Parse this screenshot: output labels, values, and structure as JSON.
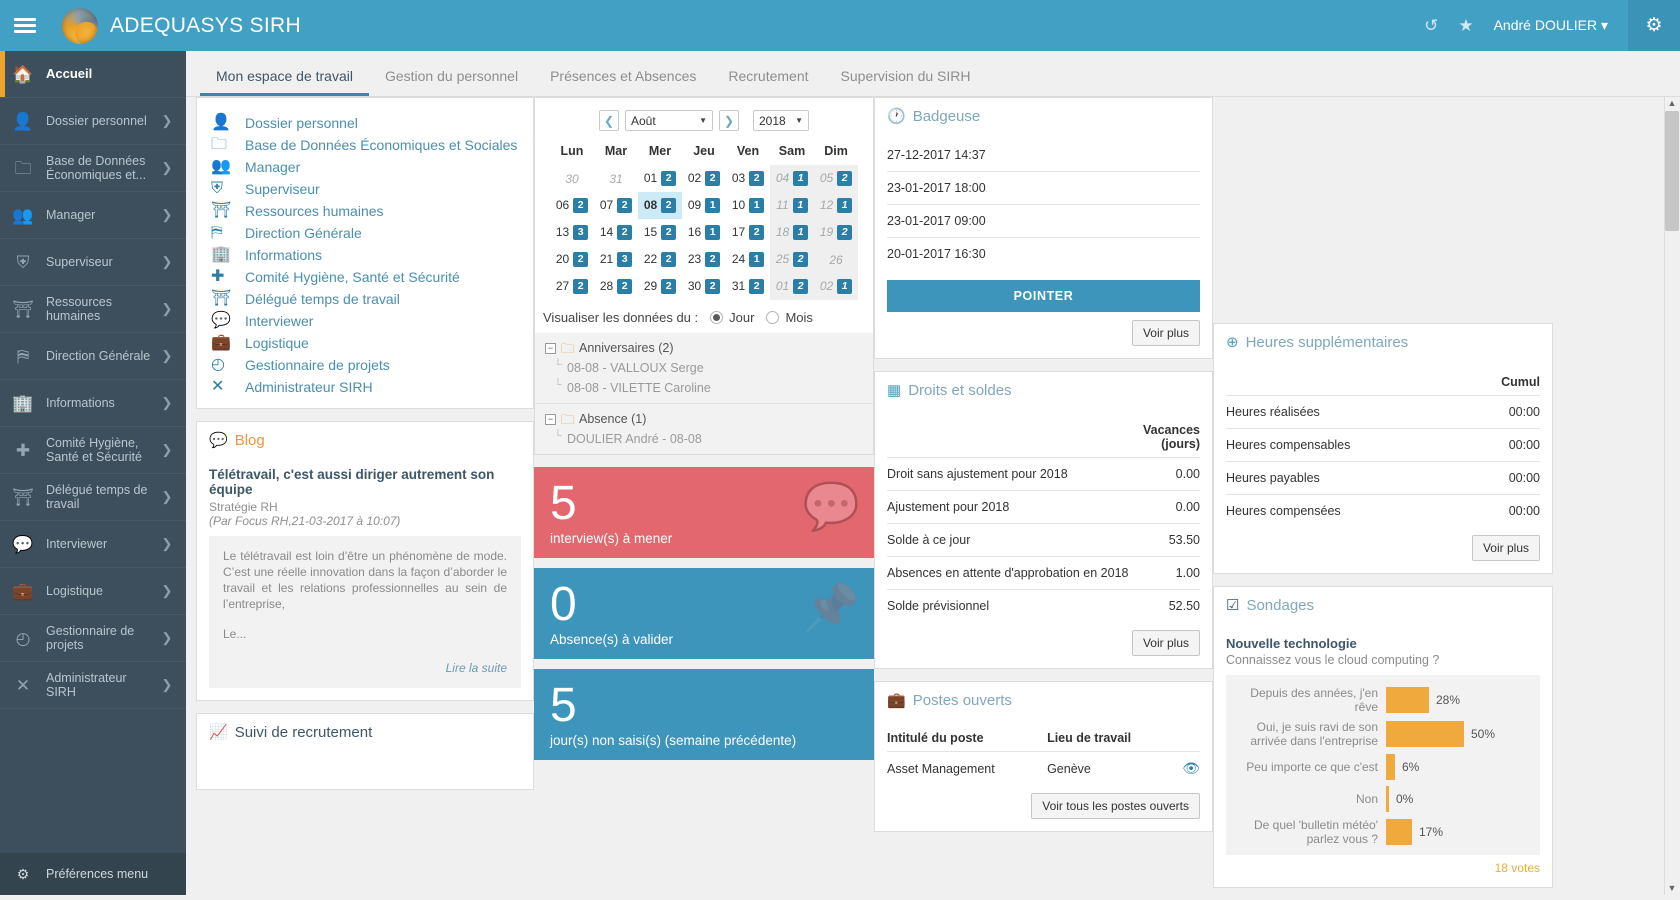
{
  "topbar": {
    "app_title": "ADEQUASYS SIRH",
    "user_name": "André DOULIER ",
    "user_caret": "▾",
    "history_icon": "↺",
    "star_icon": "★",
    "gear_icon": "⚙",
    "menu_icon": "hamburger"
  },
  "sidebar": {
    "items": [
      {
        "label": "Accueil",
        "icon": "🏠",
        "chevron": "",
        "active": true
      },
      {
        "label": "Dossier personnel",
        "icon": "👤",
        "chevron": "❯",
        "active": false
      },
      {
        "label": "Base de Données Économiques et...",
        "icon": "🗀",
        "chevron": "❯",
        "active": false
      },
      {
        "label": "Manager",
        "icon": "👥",
        "chevron": "❯",
        "active": false
      },
      {
        "label": "Superviseur",
        "icon": "⛨",
        "chevron": "❯",
        "active": false
      },
      {
        "label": "Ressources humaines",
        "icon": "⛩",
        "chevron": "❯",
        "active": false
      },
      {
        "label": "Direction Générale",
        "icon": "⛿",
        "chevron": "❯",
        "active": false
      },
      {
        "label": "Informations",
        "icon": "🏢",
        "chevron": "❯",
        "active": false
      },
      {
        "label": "Comité Hygiène, Santé et Sécurité",
        "icon": "✚",
        "chevron": "❯",
        "active": false
      },
      {
        "label": "Délégué temps de travail",
        "icon": "⛩",
        "chevron": "❯",
        "active": false
      },
      {
        "label": "Interviewer",
        "icon": "💬",
        "chevron": "❯",
        "active": false
      },
      {
        "label": "Logistique",
        "icon": "💼",
        "chevron": "❯",
        "active": false
      },
      {
        "label": "Gestionnaire de projets",
        "icon": "◴",
        "chevron": "❯",
        "active": false
      },
      {
        "label": "Administrateur SIRH",
        "icon": "✕",
        "chevron": "❯",
        "active": false
      }
    ],
    "prefs_label": "Préférences menu",
    "prefs_icon": "⚙"
  },
  "tabs": [
    {
      "label": "Mon espace de travail",
      "active": true
    },
    {
      "label": "Gestion du personnel",
      "active": false
    },
    {
      "label": "Présences et Absences",
      "active": false
    },
    {
      "label": "Recrutement",
      "active": false
    },
    {
      "label": "Supervision du SIRH",
      "active": false
    }
  ],
  "shortcuts": [
    {
      "label": "Dossier personnel",
      "icon": "👤"
    },
    {
      "label": "Base de Données Économiques et Sociales",
      "icon": "🗀"
    },
    {
      "label": "Manager",
      "icon": "👥"
    },
    {
      "label": "Superviseur",
      "icon": "⛨"
    },
    {
      "label": "Ressources humaines",
      "icon": "⛩"
    },
    {
      "label": "Direction Générale",
      "icon": "⛿"
    },
    {
      "label": "Informations",
      "icon": "🏢"
    },
    {
      "label": "Comité Hygiène, Santé et Sécurité",
      "icon": "✚"
    },
    {
      "label": "Délégué temps de travail",
      "icon": "⛩"
    },
    {
      "label": "Interviewer",
      "icon": "💬"
    },
    {
      "label": "Logistique",
      "icon": "💼"
    },
    {
      "label": "Gestionnaire de projets",
      "icon": "◴"
    },
    {
      "label": "Administrateur SIRH",
      "icon": "✕"
    }
  ],
  "blog": {
    "title": "Blog",
    "icon": "💬",
    "headline": "Télétravail, c'est aussi diriger autrement son équipe",
    "category": "Stratégie RH",
    "meta": "(Par Focus RH,21-03-2017 à 10:07)",
    "excerpt": "Le télétravail est loin d’être un phénomène de mode. C’est une réelle innovation dans la façon d’aborder le travail et les relations professionnelles au sein de l’entreprise,",
    "excerpt_cont": "Le...",
    "read_more": "Lire la suite"
  },
  "recruitment": {
    "title": "Suivi de recrutement",
    "icon": "📈"
  },
  "calendar": {
    "prev_icon": "❮",
    "next_icon": "❯",
    "month": "Août",
    "year": "2018",
    "caret": "▼",
    "day_headers": [
      "Lun",
      "Mar",
      "Mer",
      "Jeu",
      "Ven",
      "Sam",
      "Dim"
    ],
    "weeks": [
      [
        {
          "d": "30",
          "b": "",
          "other": true,
          "we": false
        },
        {
          "d": "31",
          "b": "",
          "other": true,
          "we": false
        },
        {
          "d": "01",
          "b": "2",
          "other": false,
          "we": false
        },
        {
          "d": "02",
          "b": "2",
          "other": false,
          "we": false
        },
        {
          "d": "03",
          "b": "2",
          "other": false,
          "we": false
        },
        {
          "d": "04",
          "b": "1",
          "other": true,
          "we": true
        },
        {
          "d": "05",
          "b": "2",
          "other": true,
          "we": true
        }
      ],
      [
        {
          "d": "06",
          "b": "2",
          "other": false,
          "we": false
        },
        {
          "d": "07",
          "b": "2",
          "other": false,
          "we": false
        },
        {
          "d": "08",
          "b": "2",
          "other": false,
          "we": false,
          "sel": true
        },
        {
          "d": "09",
          "b": "1",
          "other": false,
          "we": false
        },
        {
          "d": "10",
          "b": "1",
          "other": false,
          "we": false
        },
        {
          "d": "11",
          "b": "1",
          "other": true,
          "we": true
        },
        {
          "d": "12",
          "b": "1",
          "other": true,
          "we": true
        }
      ],
      [
        {
          "d": "13",
          "b": "3",
          "other": false,
          "we": false
        },
        {
          "d": "14",
          "b": "2",
          "other": false,
          "we": false
        },
        {
          "d": "15",
          "b": "2",
          "other": false,
          "we": false
        },
        {
          "d": "16",
          "b": "1",
          "other": false,
          "we": false
        },
        {
          "d": "17",
          "b": "2",
          "other": false,
          "we": false
        },
        {
          "d": "18",
          "b": "1",
          "other": true,
          "we": true
        },
        {
          "d": "19",
          "b": "2",
          "other": true,
          "we": true
        }
      ],
      [
        {
          "d": "20",
          "b": "2",
          "other": false,
          "we": false
        },
        {
          "d": "21",
          "b": "3",
          "other": false,
          "we": false
        },
        {
          "d": "22",
          "b": "2",
          "other": false,
          "we": false
        },
        {
          "d": "23",
          "b": "2",
          "other": false,
          "we": false
        },
        {
          "d": "24",
          "b": "1",
          "other": false,
          "we": false
        },
        {
          "d": "25",
          "b": "2",
          "other": true,
          "we": true
        },
        {
          "d": "26",
          "b": "",
          "other": true,
          "we": true
        }
      ],
      [
        {
          "d": "27",
          "b": "2",
          "other": false,
          "we": false
        },
        {
          "d": "28",
          "b": "2",
          "other": false,
          "we": false
        },
        {
          "d": "29",
          "b": "2",
          "other": false,
          "we": false
        },
        {
          "d": "30",
          "b": "2",
          "other": false,
          "we": false
        },
        {
          "d": "31",
          "b": "2",
          "other": false,
          "we": false
        },
        {
          "d": "01",
          "b": "2",
          "other": true,
          "we": true
        },
        {
          "d": "02",
          "b": "1",
          "other": true,
          "we": true
        }
      ]
    ],
    "visualize_label": "Visualiser les données du :",
    "radio_day": "Jour",
    "radio_month": "Mois",
    "tree": [
      {
        "group": "Anniversaires (2)",
        "items": [
          "08-08 - VALLOUX Serge",
          "08-08 - VILETTE Caroline"
        ]
      },
      {
        "group": "Absence (1)",
        "items": [
          "DOULIER André - 08-08"
        ]
      }
    ]
  },
  "tiles": [
    {
      "num": "5",
      "caption": "interview(s) à mener",
      "color": "#e3676f",
      "icon": "💬"
    },
    {
      "num": "0",
      "caption": "Absence(s) à valider",
      "color": "#3d95bb",
      "icon": "📌"
    },
    {
      "num": "5",
      "caption": "jour(s) non saisi(s) (semaine précédente)",
      "color": "#3d95bb",
      "icon": ""
    }
  ],
  "badgeuse": {
    "title": "Badgeuse",
    "icon": "🕐",
    "entries": [
      "27-12-2017 14:37",
      "23-01-2017 18:00",
      "23-01-2017 09:00",
      "20-01-2017 16:30"
    ],
    "action_label": "POINTER",
    "more_label": "Voir plus"
  },
  "droits": {
    "title": "Droits et soldes",
    "icon": "▦",
    "col_header": "Vacances\n(jours)",
    "col_header_l1": "Vacances",
    "col_header_l2": "(jours)",
    "rows": [
      {
        "label": "Droit sans ajustement pour 2018",
        "value": "0.00"
      },
      {
        "label": "Ajustement pour 2018",
        "value": "0.00"
      },
      {
        "label": "Solde à ce jour",
        "value": "53.50"
      },
      {
        "label": "Absences en attente d'approbation en 2018",
        "value": "1.00"
      },
      {
        "label": "Solde prévisionnel",
        "value": "52.50"
      }
    ],
    "more_label": "Voir plus"
  },
  "postes": {
    "title": "Postes ouverts",
    "icon": "💼",
    "headers": [
      "Intitulé du poste",
      "Lieu de travail",
      ""
    ],
    "rows": [
      {
        "poste": "Asset Management",
        "lieu": "Genève",
        "eye": "👁"
      }
    ],
    "all_label": "Voir tous les postes ouverts"
  },
  "heures": {
    "title": "Heures supplémentaires",
    "icon": "⊕",
    "col_header": "Cumul",
    "rows": [
      {
        "label": "Heures réalisées",
        "value": "00:00"
      },
      {
        "label": "Heures compensables",
        "value": "00:00"
      },
      {
        "label": "Heures payables",
        "value": "00:00"
      },
      {
        "label": "Heures compensées",
        "value": "00:00"
      }
    ],
    "more_label": "Voir plus"
  },
  "sondages": {
    "title": "Sondages",
    "icon": "☑",
    "poll_title": "Nouvelle technologie",
    "question": "Connaissez vous le cloud computing ?",
    "votes": "18 votes",
    "chart_data": {
      "type": "bar",
      "title": "Nouvelle technologie",
      "subtitle": "Connaissez vous le cloud computing ?",
      "orientation": "horizontal",
      "categories": [
        "Depuis des années, j'en rêve",
        "Oui, je suis ravi de son arrivée dans l'entreprise",
        "Peu importe ce que c'est",
        "Non",
        "De quel 'bulletin météo' parlez vous ?"
      ],
      "values": [
        28,
        50,
        6,
        0,
        17
      ],
      "value_labels": [
        "28%",
        "50%",
        "6%",
        "0%",
        "17%"
      ],
      "unit": "%",
      "bar_color": "#f0a93c",
      "total_label": "18 votes",
      "xlabel": "",
      "ylabel": "",
      "legend": "none",
      "grid": false
    }
  }
}
